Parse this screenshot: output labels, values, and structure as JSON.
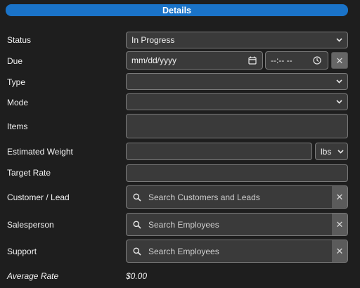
{
  "header": {
    "title": "Details"
  },
  "fields": {
    "status": {
      "label": "Status",
      "value": "In Progress"
    },
    "due": {
      "label": "Due",
      "date_placeholder": "mm/dd/yyyy",
      "time_placeholder": "--:-- --",
      "clear": "✕"
    },
    "type": {
      "label": "Type",
      "value": ""
    },
    "mode": {
      "label": "Mode",
      "value": ""
    },
    "items": {
      "label": "Items",
      "value": ""
    },
    "estimated_weight": {
      "label": "Estimated Weight",
      "value": "",
      "unit": "lbs"
    },
    "target_rate": {
      "label": "Target Rate",
      "value": ""
    },
    "customer_lead": {
      "label": "Customer / Lead",
      "placeholder": "Search Customers and Leads",
      "clear": "✕"
    },
    "salesperson": {
      "label": "Salesperson",
      "placeholder": "Search Employees",
      "clear": "✕"
    },
    "support": {
      "label": "Support",
      "placeholder": "Search Employees",
      "clear": "✕"
    },
    "average_rate": {
      "label": "Average Rate",
      "value": "$0.00"
    }
  },
  "colors": {
    "accent": "#1a73c8",
    "background": "#1e1e1e",
    "field": "#3a3a3a",
    "border": "#7a7a7a"
  }
}
